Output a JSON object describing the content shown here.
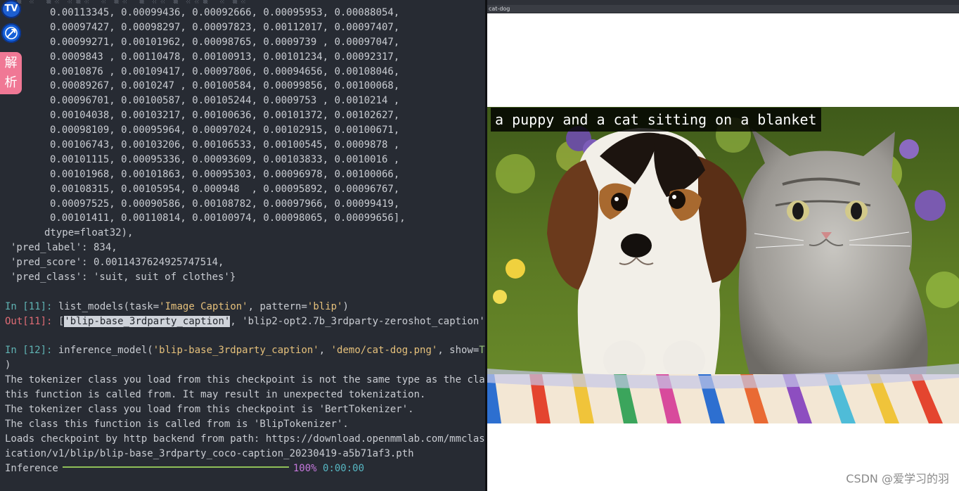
{
  "terminal": {
    "array_rows": [
      "0.00113345, 0.00099436, 0.00092666, 0.00095953, 0.00088054,",
      "0.00097427, 0.00098297, 0.00097823, 0.00112017, 0.00097407,",
      "0.00099271, 0.00101962, 0.00098765, 0.0009739 , 0.00097047,",
      "0.0009843 , 0.00110478, 0.00100913, 0.00101234, 0.00092317,",
      "0.0010876 , 0.00109417, 0.00097806, 0.00094656, 0.00108046,",
      "0.00089267, 0.0010247 , 0.00100584, 0.00099856, 0.00100068,",
      "0.00096701, 0.00100587, 0.00105244, 0.0009753 , 0.0010214 ,",
      "0.00104038, 0.00103217, 0.00100636, 0.00101372, 0.00102627,",
      "0.00098109, 0.00095964, 0.00097024, 0.00102915, 0.00100671,",
      "0.00106743, 0.00103206, 0.00106533, 0.00100545, 0.0009878 ,",
      "0.00101115, 0.00095336, 0.00093609, 0.00103833, 0.0010016 ,",
      "0.00101968, 0.00101863, 0.00095303, 0.00096978, 0.00100066,",
      "0.00108315, 0.00105954, 0.000948  , 0.00095892, 0.00096767,",
      "0.00097525, 0.00090586, 0.00108782, 0.00097966, 0.00099419,",
      "0.00101411, 0.00110814, 0.00100974, 0.00098065, 0.00099656],"
    ],
    "dtype_line": "dtype=float32),",
    "pred_label_line": "'pred_label': 834,",
    "pred_score_line": "'pred_score': 0.0011437624925747514,",
    "pred_class_line": "'pred_class': 'suit, suit of clothes'}",
    "in11": {
      "prompt": "In [11]:",
      "call": "list_models(task=",
      "task": "'Image Caption'",
      "mid": ", pattern=",
      "pattern": "'blip'",
      "end": ")"
    },
    "out11": {
      "prompt": "Out[11]:",
      "open": "[",
      "item1": "'blip-base_3rdparty_caption'",
      "sep": ", ",
      "item2": "'blip2-opt2.7b_3rdparty-zeroshot_caption'",
      "close": "]"
    },
    "in12": {
      "prompt": "In [12]:",
      "call": "inference_model(",
      "model": "'blip-base_3rdparty_caption'",
      "sep": ", ",
      "image": "'demo/cat-dog.png'",
      "kwarg": ", show=",
      "show_value": "True",
      "close": ")"
    },
    "log_lines": [
      "The tokenizer class you load from this checkpoint is not the same type as the class",
      "this function is called from. It may result in unexpected tokenization.",
      "The tokenizer class you load from this checkpoint is 'BertTokenizer'.",
      "The class this function is called from is 'BlipTokenizer'.",
      "Loads checkpoint by http backend from path: https://download.openmmlab.com/mmclassif",
      "ication/v1/blip/blip-base_3rdparty_coco-caption_20230419-a5b71af3.pth"
    ],
    "progress": {
      "label": "Inference",
      "value": 1.0,
      "percent_text": "100%",
      "elapsed": "0:00:00"
    }
  },
  "side_icons": {
    "tv_icon_text": "TV",
    "parse_button": [
      "解",
      "析"
    ]
  },
  "viewer": {
    "window_title": "cat-dog",
    "caption": "a puppy and a cat sitting on a blanket"
  },
  "watermark": "CSDN @爱学习的羽",
  "colors": {
    "terminal_bg": "#272b33",
    "prompt_in": "#5fb3b3",
    "prompt_out": "#e06c75",
    "string": "#e5c07b",
    "keyword_true": "#98c379",
    "progress_bar": "#8fbf58",
    "parse_button": "#f07895"
  }
}
